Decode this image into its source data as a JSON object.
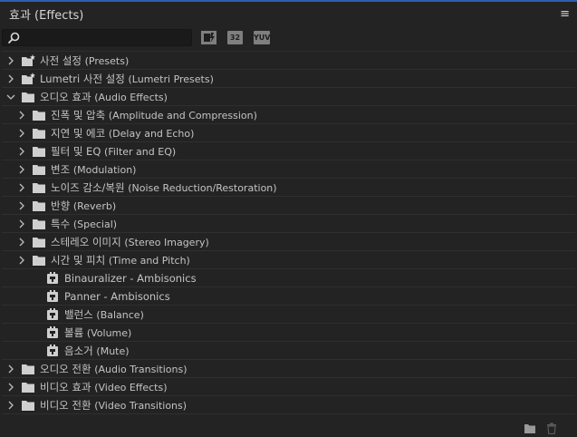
{
  "panel": {
    "title": "효과 (Effects)",
    "menu_icon": "≡"
  },
  "search": {
    "value": "",
    "placeholder": ""
  },
  "filters": {
    "accelerated": "",
    "bit32": "32",
    "yuv": "YUV"
  },
  "tree": [
    {
      "label": "사전 설정",
      "en": "(Presets)",
      "level": 0,
      "kind": "preset-folder",
      "expanded": false
    },
    {
      "label": "Lumetri 사전 설정",
      "en": "(Lumetri Presets)",
      "level": 0,
      "kind": "preset-folder",
      "expanded": false
    },
    {
      "label": "오디오 효과",
      "en": "(Audio Effects)",
      "level": 0,
      "kind": "folder",
      "expanded": true
    },
    {
      "label": "진폭 및 압축",
      "en": "(Amplitude and Compression)",
      "level": 1,
      "kind": "folder",
      "expanded": false
    },
    {
      "label": "지연 및 에코",
      "en": "(Delay and Echo)",
      "level": 1,
      "kind": "folder",
      "expanded": false
    },
    {
      "label": "필터 및 EQ",
      "en": "(Filter and EQ)",
      "level": 1,
      "kind": "folder",
      "expanded": false
    },
    {
      "label": "변조",
      "en": "(Modulation)",
      "level": 1,
      "kind": "folder",
      "expanded": false
    },
    {
      "label": "노이즈 감소/복원",
      "en": "(Noise Reduction/Restoration)",
      "level": 1,
      "kind": "folder",
      "expanded": false
    },
    {
      "label": "반향",
      "en": "(Reverb)",
      "level": 1,
      "kind": "folder",
      "expanded": false
    },
    {
      "label": "특수",
      "en": "(Special)",
      "level": 1,
      "kind": "folder",
      "expanded": false
    },
    {
      "label": "스테레오 이미지",
      "en": "(Stereo Imagery)",
      "level": 1,
      "kind": "folder",
      "expanded": false
    },
    {
      "label": "시간 및 피치",
      "en": "(Time and Pitch)",
      "level": 1,
      "kind": "folder",
      "expanded": false
    },
    {
      "label": "Binauralizer - Ambisonics",
      "en": "",
      "level": 1,
      "kind": "effect"
    },
    {
      "label": "Panner - Ambisonics",
      "en": "",
      "level": 1,
      "kind": "effect"
    },
    {
      "label": "밸런스",
      "en": "(Balance)",
      "level": 1,
      "kind": "effect"
    },
    {
      "label": "볼륨",
      "en": "(Volume)",
      "level": 1,
      "kind": "effect"
    },
    {
      "label": "음소거",
      "en": "(Mute)",
      "level": 1,
      "kind": "effect"
    },
    {
      "label": "오디오 전환",
      "en": "(Audio Transitions)",
      "level": 0,
      "kind": "folder",
      "expanded": false
    },
    {
      "label": "비디오 효과",
      "en": "(Video Effects)",
      "level": 0,
      "kind": "folder",
      "expanded": false
    },
    {
      "label": "비디오 전환",
      "en": "(Video Transitions)",
      "level": 0,
      "kind": "folder",
      "expanded": false
    }
  ],
  "bottom": {
    "new_folder_icon": "new-custom-bin-icon",
    "delete_icon": "trash-icon"
  },
  "colors": {
    "background": "#232323",
    "accent_line": "#2b5fb0",
    "text": "#c4c4c4",
    "icon": "#d0d0d0"
  }
}
